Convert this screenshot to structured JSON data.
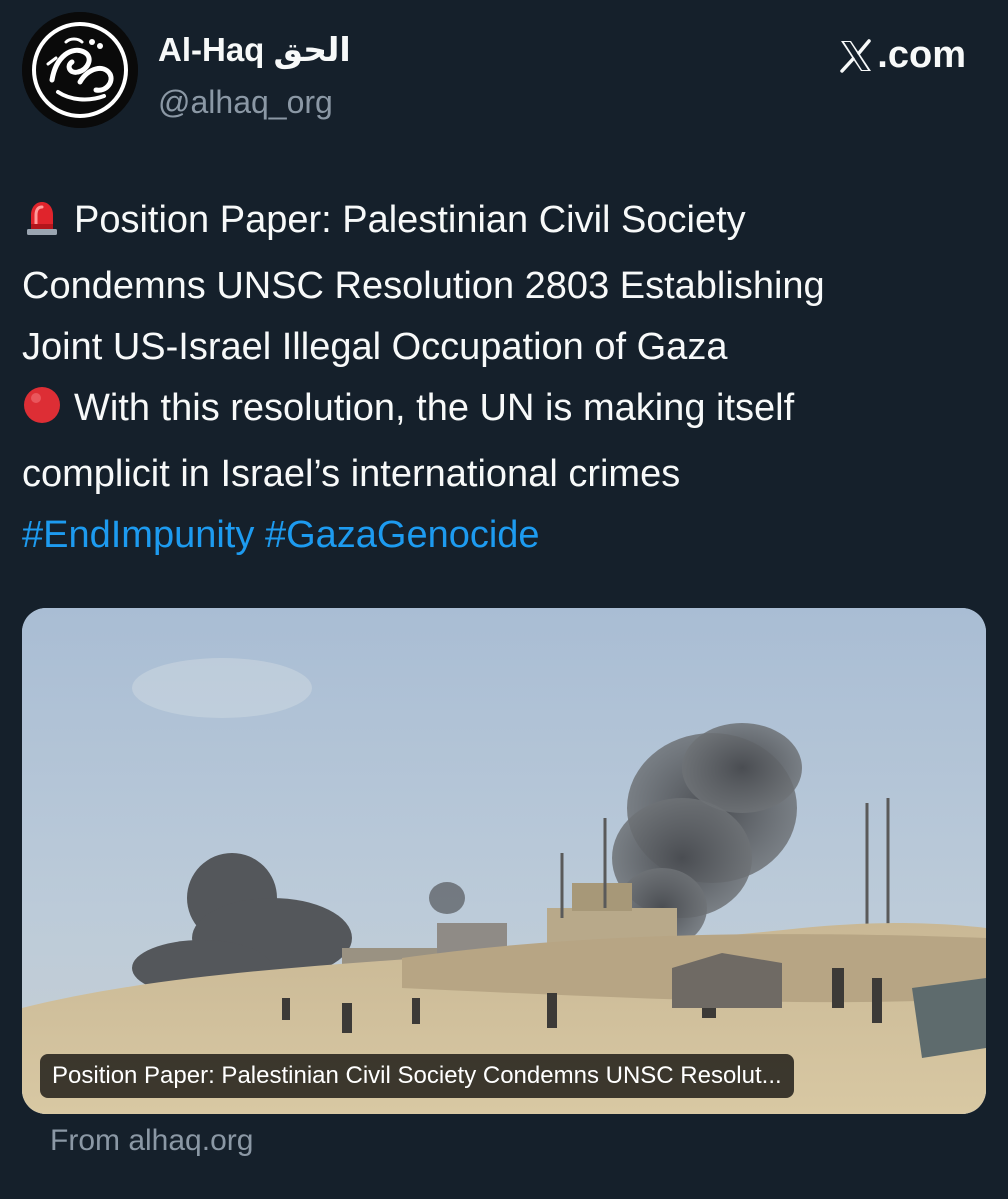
{
  "account": {
    "display_name": "Al-Haq الحق",
    "handle": "@alhaq_org",
    "avatar_icon": "al-haq-logo"
  },
  "site": {
    "label": ".com",
    "icon": "x-logo-icon"
  },
  "tweet": {
    "line1": "Position Paper: Palestinian Civil Society",
    "line2": "Condemns UNSC Resolution 2803 Establishing",
    "line3": "Joint US-Israel Illegal Occupation of Gaza",
    "line4": "With this resolution, the UN is making itself",
    "line5": "complicit in Israel’s international crimes",
    "hashtags": [
      "#EndImpunity",
      "#GazaGenocide"
    ],
    "emoji_1": "rotating-light-icon",
    "emoji_2": "red-circle-icon"
  },
  "card": {
    "caption": "Position Paper: Palestinian Civil Society Condemns UNSC Resolut...",
    "image_icon": "smoke-over-gaza-photo"
  },
  "source": {
    "label": "From alhaq.org"
  },
  "colors": {
    "background": "#15202b",
    "text": "#f7f9f9",
    "secondary": "#8b98a5",
    "hashtag": "#1d9bf0"
  }
}
